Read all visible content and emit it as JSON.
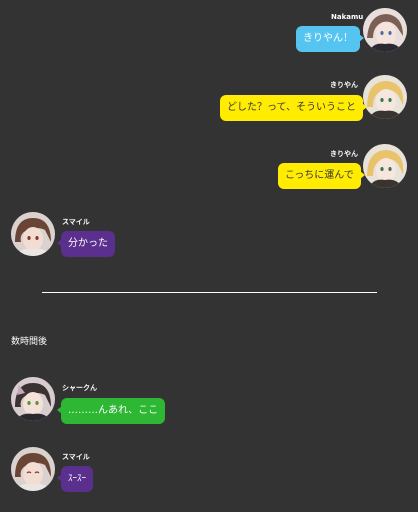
{
  "colors": {
    "background": "#333333",
    "blue": "#56c4f0",
    "yellow": "#ffec00",
    "purple": "#5b2f8d",
    "green": "#2db733"
  },
  "messages": [
    {
      "name": "Nakamu",
      "text": "きりやん！"
    },
    {
      "name": "きりやん",
      "text": "どした？って、そういうこと"
    },
    {
      "name": "きりやん",
      "text": "こっちに運んで"
    },
    {
      "name": "スマイル",
      "text": "分かった"
    },
    {
      "name": "シャークん",
      "text": "………んあれ、ここ"
    },
    {
      "name": "スマイル",
      "text": "ｽｰｽｰ"
    }
  ],
  "time_skip": "数時間後",
  "avatars": {
    "nakamu": "nakamu-avatar",
    "kiriyan": "kiriyan-avatar",
    "smile": "smile-avatar",
    "shark": "shark-avatar"
  }
}
